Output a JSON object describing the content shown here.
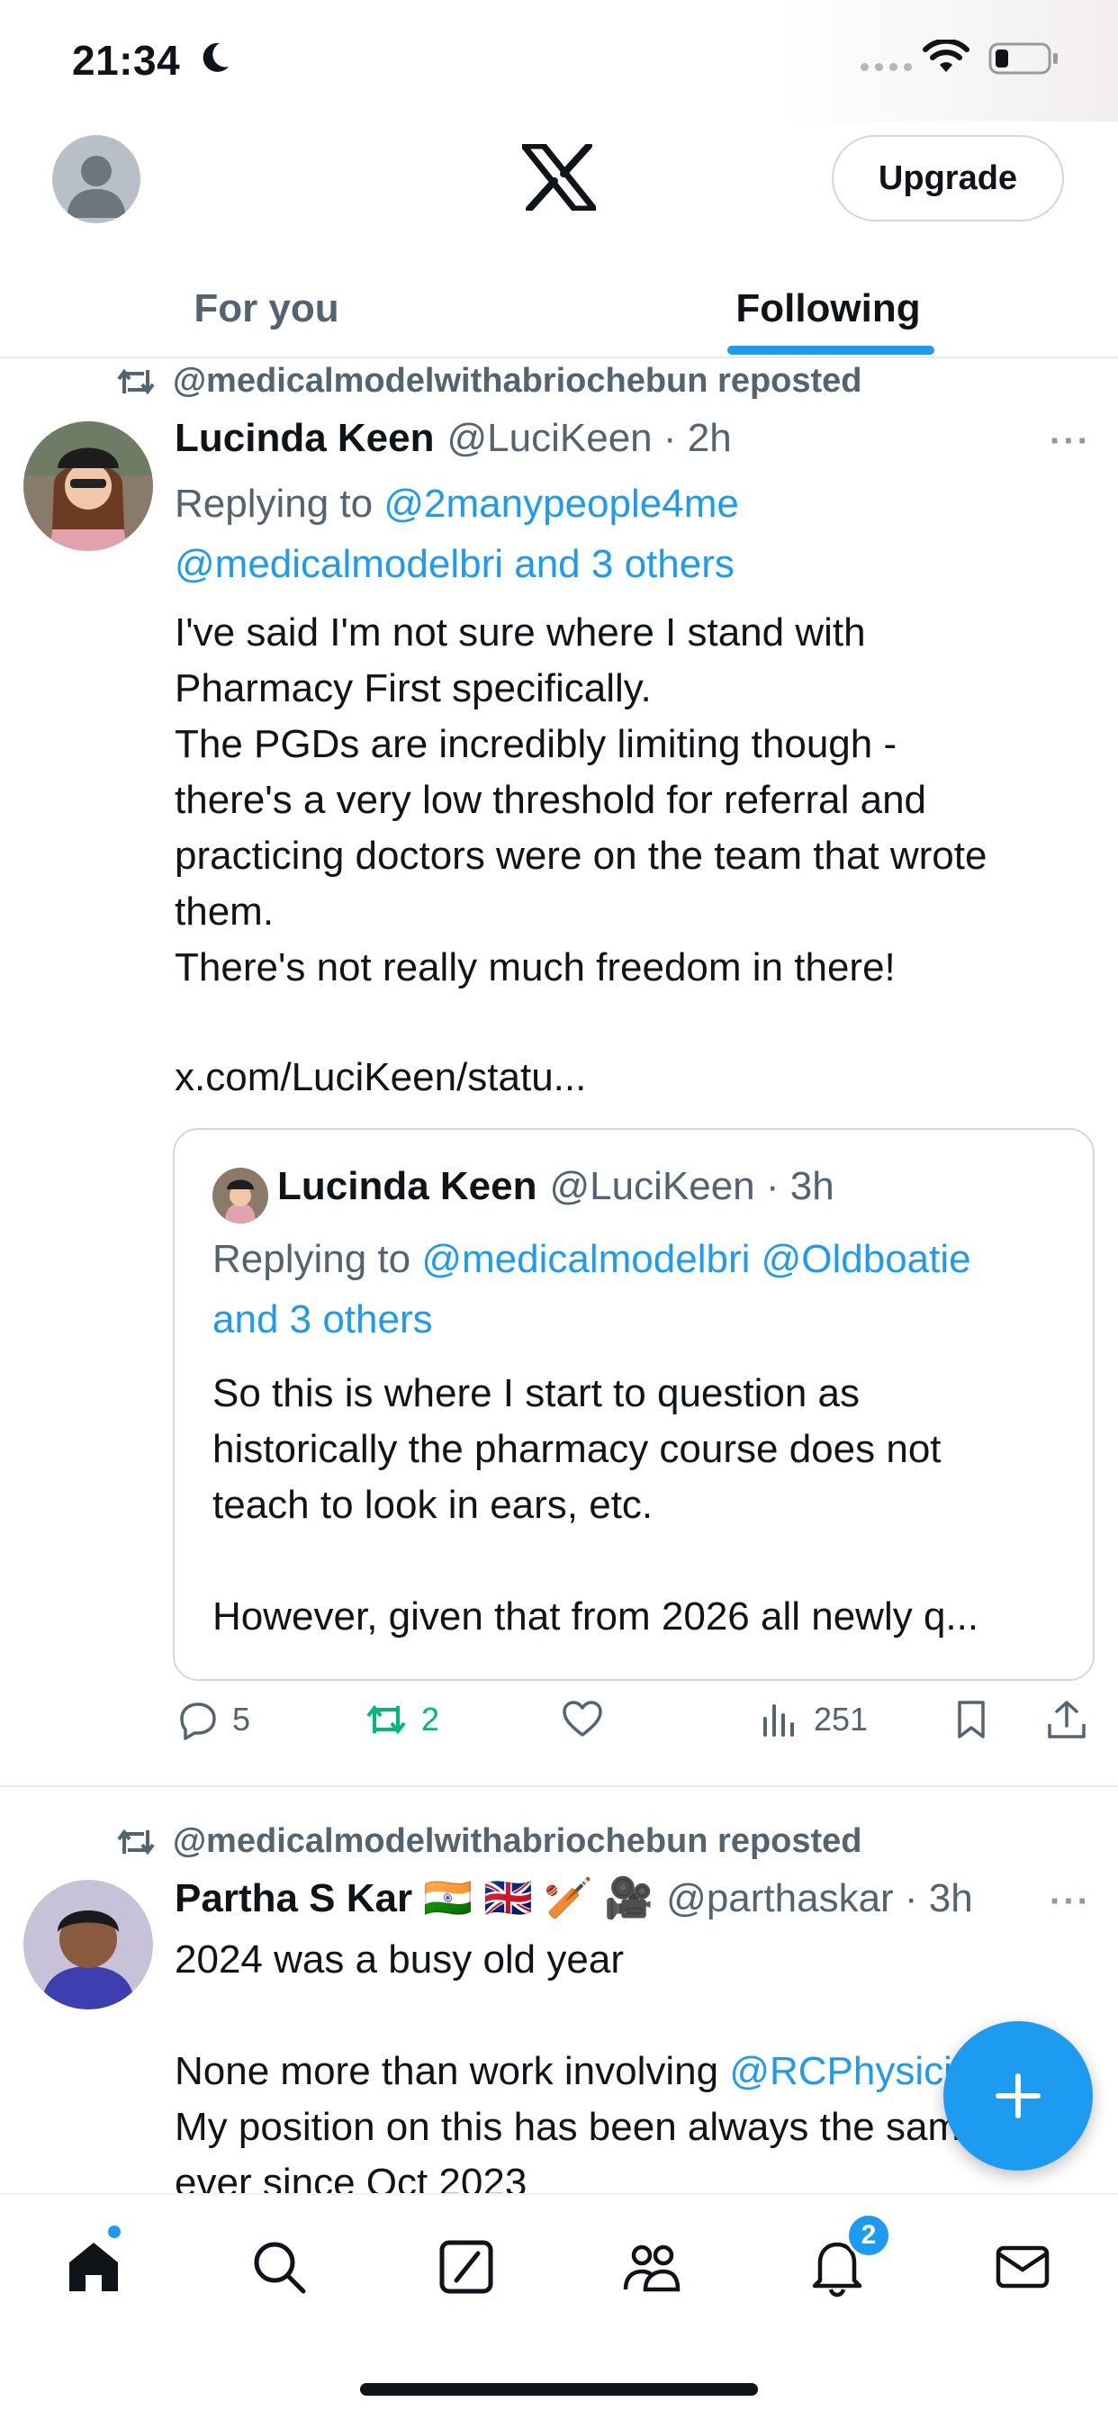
{
  "status_bar": {
    "time": "21:34"
  },
  "header": {
    "upgrade_label": "Upgrade"
  },
  "tabs": [
    {
      "label": "For you",
      "active": false
    },
    {
      "label": "Following",
      "active": true
    }
  ],
  "posts": [
    {
      "repost_text": "@medicalmodelwithabriochebun reposted",
      "author_name": "Lucinda Keen",
      "handle_time": "@LuciKeen · 2h",
      "reply_prefix": "Replying to ",
      "reply_line1_link": "@2manypeople4me",
      "reply_line2_link": "@medicalmodelbri and 3 others",
      "body": "I've said I'm not sure where I stand with\nPharmacy First specifically.\nThe PGDs are incredibly limiting though -\nthere's a very low threshold for referral and\npracticing doctors were on the team that wrote\nthem.\nThere's not really much freedom in there!",
      "link": "x.com/LuciKeen/statu...",
      "quote": {
        "author_name": "Lucinda Keen",
        "handle_time": "@LuciKeen · 3h",
        "reply_prefix": "Replying to ",
        "reply_links": "@medicalmodelbri @Oldboatie",
        "reply_line2": "and 3 others",
        "body": "So this is where I start to question as\nhistorically the pharmacy course does not\nteach to look in ears, etc.\n\nHowever, given that from 2026 all newly q..."
      },
      "actions": {
        "replies": "5",
        "reposts": "2",
        "views": "251"
      }
    },
    {
      "repost_text": "@medicalmodelwithabriochebun reposted",
      "author_name": "Partha S Kar 🇮🇳 🇬🇧 🏏 🎥",
      "handle_time": "@parthaskar · 3h",
      "body_line1": "2024 was a busy old year",
      "body_line2_prefix": "None more than work involving ",
      "body_line2_link": "@RCPhysicians",
      "body_rest": "My position on this has been always the same\never since Oct 2023"
    }
  ],
  "nav": {
    "notifications_badge": "2",
    "items": [
      "home",
      "search",
      "grok",
      "communities",
      "notifications",
      "messages"
    ]
  },
  "colors": {
    "accent": "#1d9bf0",
    "repost_green": "#00ba7c",
    "muted": "#536471"
  }
}
